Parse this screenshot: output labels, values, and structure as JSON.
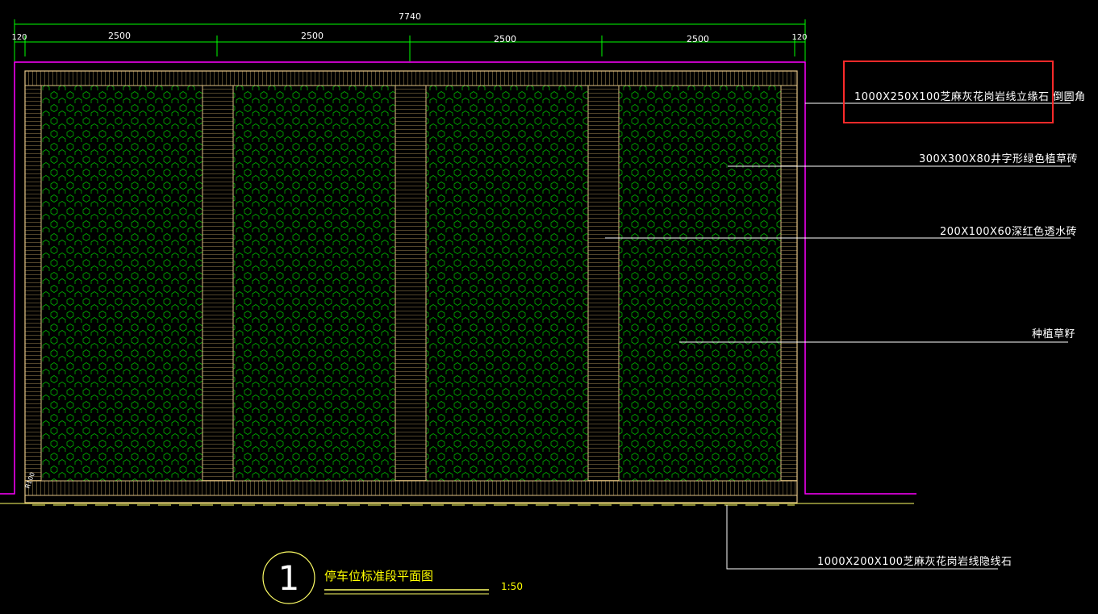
{
  "dimensions": {
    "overall": "7740",
    "left_edge": "120",
    "spans": [
      "2500",
      "2500",
      "2500",
      "2500"
    ],
    "right_edge": "120"
  },
  "labels": {
    "curb_stone": "1000X250X100芝麻灰花岗岩线立缘石 倒圆角",
    "grass_brick": "300X300X80井字形绿色植草砖",
    "permeable_brick": "200X100X60深红色透水砖",
    "grass_seed": "种植草籽",
    "flush_curb": "1000X200X100芝麻灰花岗岩线隐线石"
  },
  "corner_note": "R100",
  "title": {
    "number": "1",
    "name": "停车位标准段平面图",
    "scale": "1:50"
  },
  "colors": {
    "background": "#000000",
    "dimension": "#00ff00",
    "outline": "#ff00ff",
    "paving": "#e8c98a",
    "hex_pattern": "#00c000",
    "leader": "#ffffff",
    "title": "#ffff00",
    "highlight": "#ff2a2a"
  }
}
